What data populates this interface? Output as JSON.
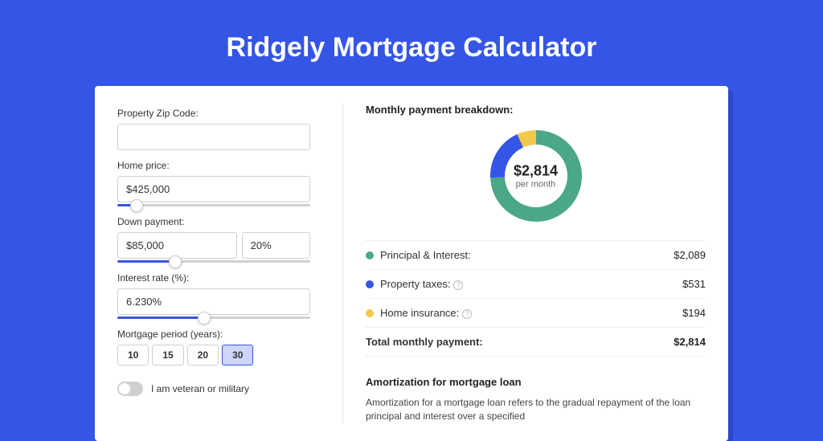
{
  "title": "Ridgely Mortgage Calculator",
  "form": {
    "zip_label": "Property Zip Code:",
    "home_label": "Home price:",
    "home_value": "$425,000",
    "down_label": "Down payment:",
    "down_value": "$85,000",
    "down_pct": "20%",
    "rate_label": "Interest rate (%):",
    "rate_value": "6.230%",
    "period_label": "Mortgage period (years):",
    "periods": [
      "10",
      "15",
      "20",
      "30"
    ],
    "period_active": 3,
    "veteran_label": "I am veteran or military"
  },
  "breakdown": {
    "title": "Monthly payment breakdown:",
    "total_value": "$2,814",
    "total_sub": "per month",
    "items": [
      {
        "label": "Principal & Interest:",
        "amount": "$2,089",
        "color": "#4aa789",
        "has_info": false
      },
      {
        "label": "Property taxes:",
        "amount": "$531",
        "color": "#3555e5",
        "has_info": true
      },
      {
        "label": "Home insurance:",
        "amount": "$194",
        "color": "#f3c94b",
        "has_info": true
      }
    ],
    "total_label": "Total monthly payment:",
    "total_amount": "$2,814"
  },
  "amortization": {
    "title": "Amortization for mortgage loan",
    "text": "Amortization for a mortgage loan refers to the gradual repayment of the loan principal and interest over a specified"
  },
  "chart_data": {
    "type": "pie",
    "title": "Monthly payment breakdown",
    "series": [
      {
        "name": "Principal & Interest",
        "value": 2089,
        "color": "#4aa789"
      },
      {
        "name": "Property taxes",
        "value": 531,
        "color": "#3555e5"
      },
      {
        "name": "Home insurance",
        "value": 194,
        "color": "#f3c94b"
      }
    ],
    "total": 2814
  }
}
